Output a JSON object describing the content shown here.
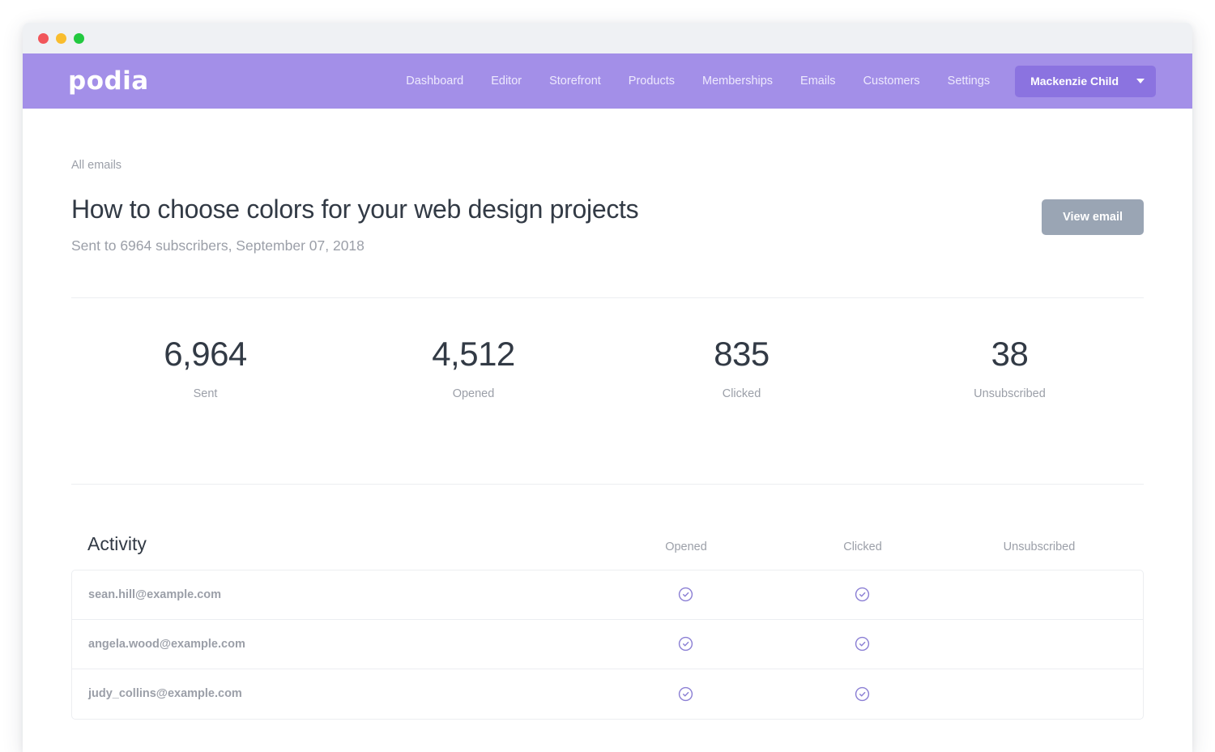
{
  "window": {
    "traffic_lights": [
      "close",
      "minimize",
      "maximize"
    ]
  },
  "header": {
    "logo": "podia",
    "nav": [
      {
        "label": "Dashboard"
      },
      {
        "label": "Editor"
      },
      {
        "label": "Storefront"
      },
      {
        "label": "Products"
      },
      {
        "label": "Memberships"
      },
      {
        "label": "Emails"
      },
      {
        "label": "Customers"
      },
      {
        "label": "Settings"
      }
    ],
    "account": {
      "name": "Mackenzie Child",
      "caret_icon": "chevron-down-icon"
    },
    "brand_color": "#a38fe8",
    "account_button_color": "#8b73e0"
  },
  "main": {
    "breadcrumb": "All emails",
    "title": "How to choose colors for your web design projects",
    "subtitle": "Sent to 6964 subscribers, September 07, 2018",
    "view_email_label": "View email",
    "view_email_color": "#9aa5b4"
  },
  "stats": [
    {
      "value": "6,964",
      "label": "Sent"
    },
    {
      "value": "4,512",
      "label": "Opened"
    },
    {
      "value": "835",
      "label": "Clicked"
    },
    {
      "value": "38",
      "label": "Unsubscribed"
    }
  ],
  "activity": {
    "title": "Activity",
    "columns": [
      "Opened",
      "Clicked",
      "Unsubscribed"
    ],
    "check_icon": "check-circle-icon",
    "check_color": "#8b7fd4",
    "rows": [
      {
        "email": "sean.hill@example.com",
        "opened": true,
        "clicked": true,
        "unsubscribed": false
      },
      {
        "email": "angela.wood@example.com",
        "opened": true,
        "clicked": true,
        "unsubscribed": false
      },
      {
        "email": "judy_collins@example.com",
        "opened": true,
        "clicked": true,
        "unsubscribed": false
      }
    ]
  }
}
